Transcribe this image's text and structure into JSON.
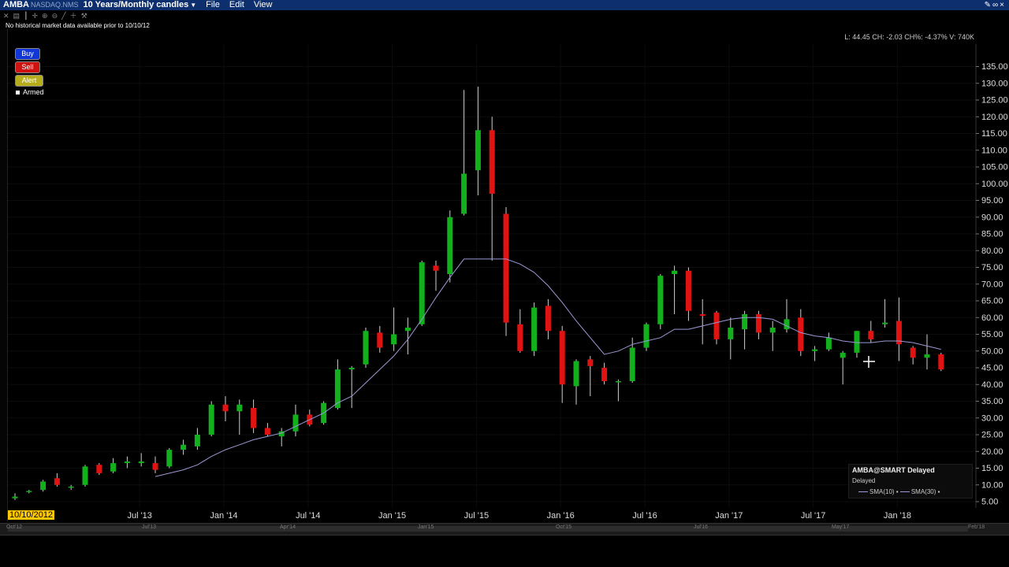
{
  "titlebar": {
    "symbol": "AMBA",
    "exchange": "NASDAQ.NMS",
    "period": "10 Years/Monthly candles",
    "menu_file": "File",
    "menu_edit": "Edit",
    "menu_view": "View"
  },
  "history_note": "No historical market data available prior to 10/10/12",
  "status_line": "L: 44.45 CH: -2.03 CH%: -4.37% V: 740K",
  "trade_buttons": {
    "buy": "Buy",
    "sell": "Sell",
    "alert": "Alert",
    "armed": "Armed"
  },
  "legend": {
    "title": "AMBA@SMART Delayed",
    "status": "Delayed",
    "sma10": "SMA(10)",
    "sma30": "SMA(30)"
  },
  "date_badge": "10/10/2012",
  "scroller_labels": [
    "Oct'12",
    "Jul'13",
    "Apr'14",
    "Jan'15",
    "Oct'15",
    "Jul'16",
    "May'17",
    "Feb'18"
  ],
  "colors": {
    "up": "#12b01c",
    "down": "#e01212",
    "sma": "#9a98d6",
    "background": "#000000"
  },
  "chart_data": {
    "type": "candlestick",
    "title": "",
    "ylim": [
      0,
      137.5
    ],
    "yticks": [
      5,
      10,
      15,
      20,
      25,
      30,
      35,
      40,
      45,
      50,
      55,
      60,
      65,
      70,
      75,
      80,
      85,
      90,
      95,
      100,
      105,
      110,
      115,
      120,
      125,
      130,
      135
    ],
    "ytick_labels": [
      "5.00",
      "10.00",
      "15.00",
      "20.00",
      "25.00",
      "30.00",
      "35.00",
      "40.00",
      "45.00",
      "50.00",
      "55.00",
      "60.00",
      "65.00",
      "70.00",
      "75.00",
      "80.00",
      "85.00",
      "90.00",
      "95.00",
      "100.00",
      "105.00",
      "110.00",
      "115.00",
      "120.00",
      "125.00",
      "130.00",
      "135.00"
    ],
    "x_labels": [
      {
        "label": "Jul '13",
        "index": 9
      },
      {
        "label": "Jan '14",
        "index": 15
      },
      {
        "label": "Jul '14",
        "index": 21
      },
      {
        "label": "Jan '15",
        "index": 27
      },
      {
        "label": "Jul '15",
        "index": 33
      },
      {
        "label": "Jan '16",
        "index": 39
      },
      {
        "label": "Jul '16",
        "index": 45
      },
      {
        "label": "Jan '17",
        "index": 51
      },
      {
        "label": "Jul '17",
        "index": 57
      },
      {
        "label": "Jan '18",
        "index": 63
      }
    ],
    "candles": [
      {
        "o": 6.0,
        "h": 7.5,
        "l": 5.5,
        "c": 6.5
      },
      {
        "o": 8.0,
        "h": 8.5,
        "l": 7.5,
        "c": 8.2
      },
      {
        "o": 8.5,
        "h": 11.5,
        "l": 8.0,
        "c": 11.0
      },
      {
        "o": 12.0,
        "h": 13.5,
        "l": 9.5,
        "c": 10.0
      },
      {
        "o": 9.5,
        "h": 10.0,
        "l": 8.5,
        "c": 9.5
      },
      {
        "o": 10.0,
        "h": 16.0,
        "l": 9.5,
        "c": 15.5
      },
      {
        "o": 16.0,
        "h": 16.5,
        "l": 13.0,
        "c": 13.5
      },
      {
        "o": 14.0,
        "h": 18.0,
        "l": 13.5,
        "c": 16.5
      },
      {
        "o": 16.5,
        "h": 18.5,
        "l": 15.0,
        "c": 17.0
      },
      {
        "o": 16.5,
        "h": 19.5,
        "l": 15.5,
        "c": 17.0
      },
      {
        "o": 16.5,
        "h": 18.5,
        "l": 13.5,
        "c": 14.5
      },
      {
        "o": 15.5,
        "h": 21.0,
        "l": 15.0,
        "c": 20.5
      },
      {
        "o": 20.5,
        "h": 23.5,
        "l": 19.0,
        "c": 22.0
      },
      {
        "o": 21.5,
        "h": 27.0,
        "l": 20.5,
        "c": 25.0
      },
      {
        "o": 25.0,
        "h": 35.0,
        "l": 24.5,
        "c": 34.0
      },
      {
        "o": 34.0,
        "h": 36.5,
        "l": 29.0,
        "c": 32.0
      },
      {
        "o": 32.0,
        "h": 35.5,
        "l": 25.0,
        "c": 34.0
      },
      {
        "o": 33.0,
        "h": 35.5,
        "l": 25.5,
        "c": 27.0
      },
      {
        "o": 27.0,
        "h": 28.5,
        "l": 24.5,
        "c": 25.0
      },
      {
        "o": 24.5,
        "h": 27.0,
        "l": 21.5,
        "c": 26.0
      },
      {
        "o": 26.0,
        "h": 34.0,
        "l": 24.5,
        "c": 31.0
      },
      {
        "o": 31.0,
        "h": 32.5,
        "l": 27.5,
        "c": 28.0
      },
      {
        "o": 28.5,
        "h": 35.0,
        "l": 28.0,
        "c": 34.5
      },
      {
        "o": 33.0,
        "h": 47.5,
        "l": 32.5,
        "c": 44.5
      },
      {
        "o": 44.5,
        "h": 45.5,
        "l": 33.0,
        "c": 45.0
      },
      {
        "o": 46.0,
        "h": 57.0,
        "l": 45.0,
        "c": 56.0
      },
      {
        "o": 55.5,
        "h": 57.5,
        "l": 49.5,
        "c": 51.0
      },
      {
        "o": 52.0,
        "h": 63.0,
        "l": 50.0,
        "c": 55.0
      },
      {
        "o": 56.0,
        "h": 60.0,
        "l": 49.0,
        "c": 57.0
      },
      {
        "o": 58.0,
        "h": 77.0,
        "l": 57.5,
        "c": 76.5
      },
      {
        "o": 75.5,
        "h": 77.0,
        "l": 68.0,
        "c": 74.0
      },
      {
        "o": 73.0,
        "h": 92.0,
        "l": 70.5,
        "c": 90.0
      },
      {
        "o": 91.0,
        "h": 128.0,
        "l": 90.5,
        "c": 103.0
      },
      {
        "o": 104.0,
        "h": 129.0,
        "l": 96.5,
        "c": 116.0
      },
      {
        "o": 116.0,
        "h": 120.0,
        "l": 77.0,
        "c": 97.0
      },
      {
        "o": 91.0,
        "h": 93.0,
        "l": 54.5,
        "c": 58.5
      },
      {
        "o": 58.0,
        "h": 62.5,
        "l": 49.5,
        "c": 50.0
      },
      {
        "o": 50.0,
        "h": 64.5,
        "l": 48.5,
        "c": 63.0
      },
      {
        "o": 63.5,
        "h": 65.5,
        "l": 53.5,
        "c": 56.0
      },
      {
        "o": 56.0,
        "h": 57.5,
        "l": 34.5,
        "c": 40.0
      },
      {
        "o": 39.5,
        "h": 47.5,
        "l": 34.0,
        "c": 47.0
      },
      {
        "o": 47.5,
        "h": 48.5,
        "l": 36.5,
        "c": 45.5
      },
      {
        "o": 45.0,
        "h": 46.5,
        "l": 40.0,
        "c": 41.0
      },
      {
        "o": 41.0,
        "h": 41.5,
        "l": 35.0,
        "c": 41.0
      },
      {
        "o": 41.0,
        "h": 54.0,
        "l": 40.5,
        "c": 51.0
      },
      {
        "o": 51.0,
        "h": 58.5,
        "l": 50.0,
        "c": 58.0
      },
      {
        "o": 58.0,
        "h": 73.0,
        "l": 56.5,
        "c": 72.5
      },
      {
        "o": 73.0,
        "h": 75.5,
        "l": 61.0,
        "c": 74.0
      },
      {
        "o": 74.0,
        "h": 75.0,
        "l": 59.0,
        "c": 62.0
      },
      {
        "o": 61.0,
        "h": 65.5,
        "l": 52.0,
        "c": 60.5
      },
      {
        "o": 61.5,
        "h": 62.0,
        "l": 52.0,
        "c": 53.5
      },
      {
        "o": 53.5,
        "h": 60.0,
        "l": 47.5,
        "c": 57.0
      },
      {
        "o": 56.5,
        "h": 62.0,
        "l": 50.5,
        "c": 61.0
      },
      {
        "o": 61.0,
        "h": 62.0,
        "l": 53.5,
        "c": 55.5
      },
      {
        "o": 55.5,
        "h": 59.0,
        "l": 50.0,
        "c": 57.0
      },
      {
        "o": 56.5,
        "h": 65.5,
        "l": 55.5,
        "c": 59.5
      },
      {
        "o": 60.0,
        "h": 62.5,
        "l": 48.5,
        "c": 50.0
      },
      {
        "o": 50.0,
        "h": 51.5,
        "l": 47.0,
        "c": 50.5
      },
      {
        "o": 50.5,
        "h": 55.5,
        "l": 50.0,
        "c": 54.0
      },
      {
        "o": 48.0,
        "h": 50.0,
        "l": 40.0,
        "c": 49.5
      },
      {
        "o": 49.5,
        "h": 56.0,
        "l": 48.0,
        "c": 56.0
      },
      {
        "o": 56.0,
        "h": 59.0,
        "l": 52.5,
        "c": 53.5
      },
      {
        "o": 58.0,
        "h": 65.5,
        "l": 57.0,
        "c": 58.5
      },
      {
        "o": 59.0,
        "h": 66.0,
        "l": 47.0,
        "c": 52.0
      },
      {
        "o": 51.0,
        "h": 51.5,
        "l": 46.0,
        "c": 48.0
      },
      {
        "o": 48.0,
        "h": 55.0,
        "l": 44.5,
        "c": 49.0
      },
      {
        "o": 49.0,
        "h": 49.5,
        "l": 44.0,
        "c": 44.5
      }
    ],
    "sma": [
      [
        10,
        12.5
      ],
      [
        11,
        13.5
      ],
      [
        12,
        14.5
      ],
      [
        13,
        16.0
      ],
      [
        14,
        18.5
      ],
      [
        15,
        20.5
      ],
      [
        16,
        22.0
      ],
      [
        17,
        23.5
      ],
      [
        18,
        24.5
      ],
      [
        19,
        25.5
      ],
      [
        20,
        27.5
      ],
      [
        21,
        29.5
      ],
      [
        22,
        31.5
      ],
      [
        23,
        34.5
      ],
      [
        24,
        36.5
      ],
      [
        25,
        40.5
      ],
      [
        26,
        44.5
      ],
      [
        27,
        48.5
      ],
      [
        28,
        53.5
      ],
      [
        29,
        59.5
      ],
      [
        30,
        66.0
      ],
      [
        31,
        72.0
      ],
      [
        32,
        77.5
      ],
      [
        33,
        77.5
      ],
      [
        34,
        77.5
      ],
      [
        35,
        77.5
      ],
      [
        36,
        76.0
      ],
      [
        37,
        73.5
      ],
      [
        38,
        69.5
      ],
      [
        39,
        64.5
      ],
      [
        40,
        59.0
      ],
      [
        41,
        54.0
      ],
      [
        42,
        49.0
      ],
      [
        43,
        50.0
      ],
      [
        44,
        52.0
      ],
      [
        45,
        53.0
      ],
      [
        46,
        54.0
      ],
      [
        47,
        56.5
      ],
      [
        48,
        56.5
      ],
      [
        49,
        57.5
      ],
      [
        50,
        58.5
      ],
      [
        51,
        59.5
      ],
      [
        52,
        60.0
      ],
      [
        53,
        60.0
      ],
      [
        54,
        59.5
      ],
      [
        55,
        57.5
      ],
      [
        56,
        55.5
      ],
      [
        57,
        54.5
      ],
      [
        58,
        54.0
      ],
      [
        59,
        53.0
      ],
      [
        60,
        52.5
      ],
      [
        61,
        52.5
      ],
      [
        62,
        53.0
      ],
      [
        63,
        53.0
      ],
      [
        64,
        52.5
      ],
      [
        65,
        51.5
      ],
      [
        66,
        50.5
      ]
    ]
  }
}
